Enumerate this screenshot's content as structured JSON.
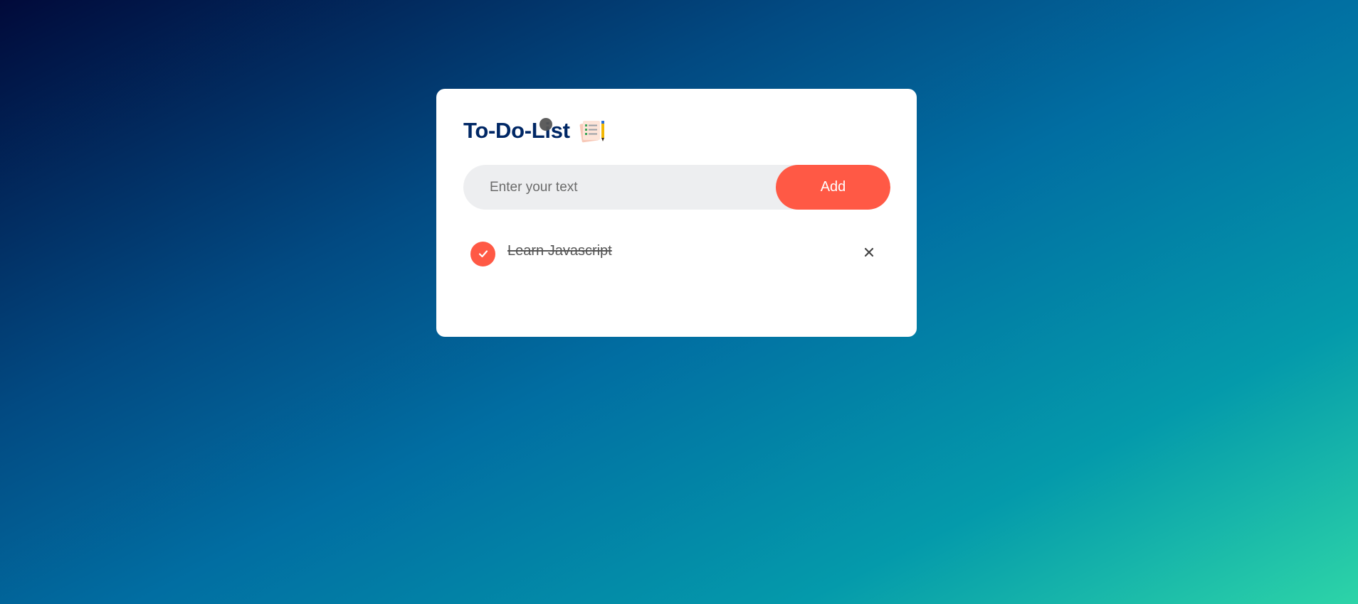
{
  "app": {
    "title": "To-Do-List",
    "title_icon": "notepad-pencil-icon"
  },
  "input": {
    "placeholder": "Enter your text",
    "value": ""
  },
  "add_button": {
    "label": "Add"
  },
  "tasks": [
    {
      "text": "Learn Javascript",
      "checked": true,
      "check_icon": "checkmark-icon",
      "delete_glyph": "×",
      "delete_icon": "close-icon"
    }
  ],
  "colors": {
    "accent": "#ff5945",
    "title": "#002765",
    "card": "#ffffff",
    "input_bg": "#edeef0",
    "gradient_start": "#010a3a",
    "gradient_end": "#2dd4a8"
  }
}
